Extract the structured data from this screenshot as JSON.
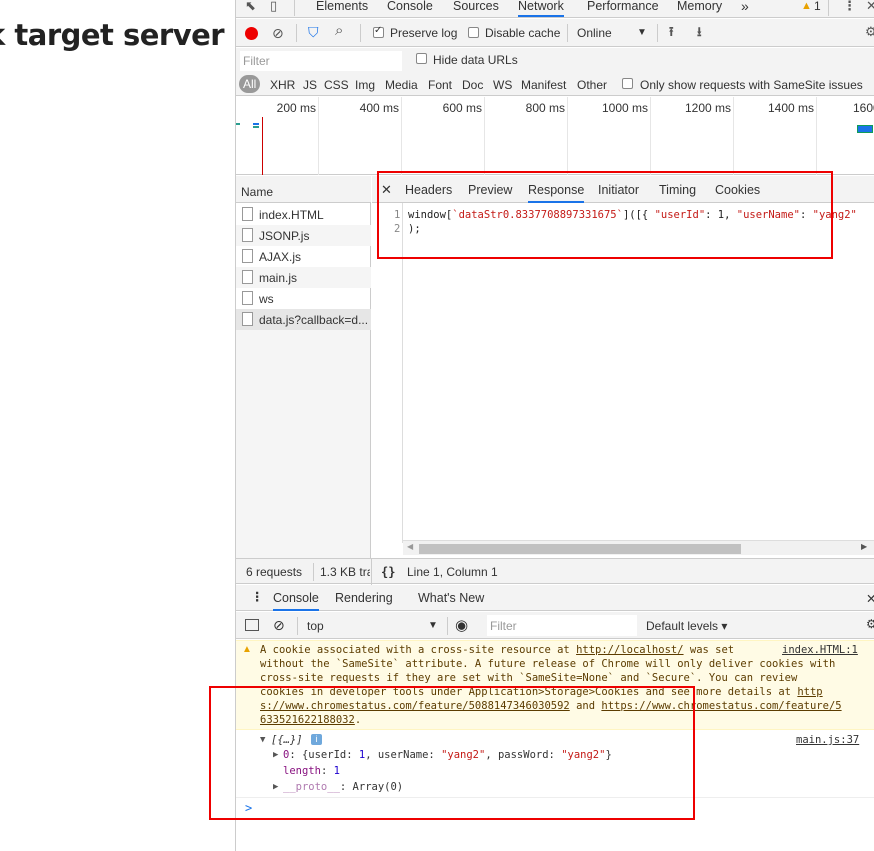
{
  "page": {
    "heading": "k target server"
  },
  "main_tabs": [
    "Elements",
    "Console",
    "Sources",
    "Network",
    "Performance",
    "Memory"
  ],
  "more_tabs": "»",
  "warnings_count": "1",
  "toolbar": {
    "preserve_log": "Preserve log",
    "disable_cache": "Disable cache",
    "throttle": "Online"
  },
  "filter": {
    "placeholder": "Filter",
    "hide_data_urls": "Hide data URLs"
  },
  "types": [
    "All",
    "XHR",
    "JS",
    "CSS",
    "Img",
    "Media",
    "Font",
    "Doc",
    "WS",
    "Manifest",
    "Other"
  ],
  "samesite_label": "Only show requests with SameSite issues",
  "timeline_ticks": [
    "200 ms",
    "400 ms",
    "600 ms",
    "800 ms",
    "1000 ms",
    "1200 ms",
    "1400 ms",
    "1600"
  ],
  "requests": {
    "header": "Name",
    "rows": [
      "index.HTML",
      "JSONP.js",
      "AJAX.js",
      "main.js",
      "ws",
      "data.js?callback=d..."
    ]
  },
  "detail_tabs": [
    "Headers",
    "Preview",
    "Response",
    "Initiator",
    "Timing",
    "Cookies"
  ],
  "response": {
    "line_numbers": [
      "1",
      "2"
    ],
    "line1_prefix": "window[",
    "line1_key": "`dataStr0.8337708897331675`",
    "line1_mid": "]([{ ",
    "line1_uid_key": "\"userId\"",
    "line1_uid_rest": ": 1, ",
    "line1_uname_key": "\"userName\"",
    "line1_uname_rest": ": ",
    "line1_uname_val": "\"yang2\"",
    "line2": ");"
  },
  "status": {
    "requests": "6 requests",
    "transferred": "1.3 KB tra",
    "braces": "{}",
    "position": "Line 1, Column 1"
  },
  "drawer_tabs": [
    "Console",
    "Rendering",
    "What's New"
  ],
  "console": {
    "context": "top",
    "filter_placeholder": "Filter",
    "levels": "Default levels ▾",
    "warning": {
      "line1_text": "A cookie associated with a cross-site resource at ",
      "line1_link": "http://localhost/",
      "line1_tail": " was set",
      "source": "index.HTML:1",
      "line2": "without the `SameSite` attribute. A future release of Chrome will only deliver cookies with",
      "line3": "cross-site requests if they are set with `SameSite=None` and `Secure`. You can review",
      "line4_text": "cookies in developer tools under Application>Storage>Cookies and see more details at ",
      "line4_link": "http",
      "line5_link1": "s://www.chromestatus.com/feature/5088147346030592",
      "line5_and": " and ",
      "line5_link2": "https://www.chromestatus.com/feature/5",
      "line6_link": "633521622188032",
      "line6_tail": "."
    },
    "log": {
      "summary": "[{…}]",
      "source": "main.js:37",
      "item0_key": "0",
      "item0_open": ": {userId: ",
      "item0_uid": "1",
      "item0_mid": ", userName: ",
      "item0_uname": "\"yang2\"",
      "item0_mid2": ", passWord: ",
      "item0_pw": "\"yang2\"",
      "item0_close": "}",
      "length_key": "length",
      "length_val": "1",
      "proto_key": "__proto__",
      "proto_val": ": Array(0)"
    },
    "prompt": ">"
  }
}
